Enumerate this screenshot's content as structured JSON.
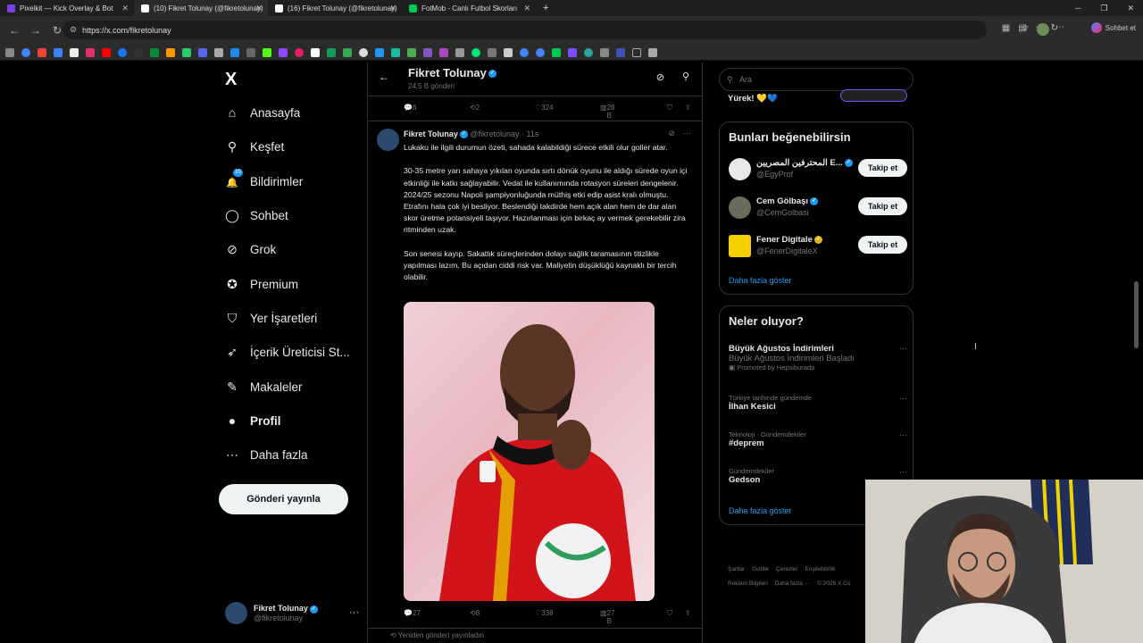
{
  "browser": {
    "tabs": [
      {
        "title": "Pixelkit — Kick Overlay & Bot",
        "color": "#7b3fe4"
      },
      {
        "title": "(10) Fikret Tolunay (@fikretolunay)",
        "color": "#ffffff"
      },
      {
        "title": "(16) Fikret Tolunay (@fikretolunay)",
        "color": "#ffffff"
      },
      {
        "title": "FotMob - Canlı Futbol Skorları",
        "color": "#00c853"
      }
    ],
    "url": "https://x.com/fikretolunay",
    "sohbet": "Sohbet et"
  },
  "leftnav": {
    "logo": "X",
    "items": [
      {
        "label": "Anasayfa",
        "icon": "home-icon",
        "glyph": "⌂"
      },
      {
        "label": "Keşfet",
        "icon": "search-icon",
        "glyph": "⚲"
      },
      {
        "label": "Bildirimler",
        "icon": "bell-icon",
        "glyph": "🔔"
      },
      {
        "label": "Sohbet",
        "icon": "chat-icon",
        "glyph": "◯"
      },
      {
        "label": "Grok",
        "icon": "grok-icon",
        "glyph": "⊘"
      },
      {
        "label": "Premium",
        "icon": "premium-icon",
        "glyph": "✪"
      },
      {
        "label": "Yer İşaretleri",
        "icon": "bookmark-icon",
        "glyph": "⛉"
      },
      {
        "label": "İçerik Üreticisi St...",
        "icon": "rocket-icon",
        "glyph": "➶"
      },
      {
        "label": "Makaleler",
        "icon": "article-icon",
        "glyph": "✎"
      },
      {
        "label": "Profil",
        "icon": "profile-icon",
        "glyph": "●"
      },
      {
        "label": "Daha fazla",
        "icon": "more-icon",
        "glyph": "⋯"
      }
    ],
    "badge": "10",
    "post_button": "Gönderi yayınla",
    "account": {
      "name": "Fikret Tolunay",
      "handle": "@fikretolunay"
    }
  },
  "main": {
    "header": {
      "name": "Fikret Tolunay",
      "count": "24,5 B gönderi"
    },
    "prev_actions": {
      "replies": "8",
      "reposts": "2",
      "likes": "324",
      "views": "28 B"
    },
    "tweet": {
      "name": "Fikret Tolunay",
      "handle": "@fikretolunay",
      "time": "· 11s",
      "paragraphs": [
        "Lukaku ile ilgili durumun özeti, sahada kalabildiği sürece etkili olur goller atar.",
        "30-35 metre yarı sahaya yıkılan oyunda sırtı dönük oyunu ile aldığı sürede oyun içi etkinliği ile katkı sağlayabilir. Vedat ile kullanımında rotasyon süreleri dengelenir. 2024/25 sezonu Napoli şampiyonluğunda müthiş etki edip asist kralı olmuştu. Etrafını hala çok iyi besliyor. Beslendiği takdirde hem açık alan hem de dar alan skor üretme potansiyeli taşıyor. Hazırlanması için birkaç ay vermek gerekebilir zira ritminden uzak.",
        "Son senesi kayıp. Sakatlık süreçlerinden dolayı sağlık taramasının titizlikle yapılması lazım. Bu açıdan ciddi risk var. Maliyetin düşüklüğü kaynaklı bir tercih olabilir."
      ],
      "actions": {
        "replies": "27",
        "reposts": "8",
        "likes": "338",
        "views": "27 B"
      }
    },
    "retweeted": "Yeniden gönderi yayınladın"
  },
  "right": {
    "search_placeholder": "Ara",
    "top_snippet": "Yürek! 💛💙",
    "suggest_title": "Bunları beğenebilirsin",
    "suggestions": [
      {
        "name": "المحترفين المصريين E...",
        "handle": "@EgyProf",
        "badge": "blue",
        "avatar_color": "#e8e8e8"
      },
      {
        "name": "Cem Gölbaşı",
        "handle": "@CemGolbasi",
        "badge": "blue",
        "avatar_color": "#6b6b5a"
      },
      {
        "name": "Fener Digitale",
        "handle": "@FenerDigitaleX",
        "badge": "gold",
        "avatar_color": "#f5d000"
      }
    ],
    "follow_label": "Takip et",
    "more_label": "Daha fazla göster",
    "trends_title": "Neler oluyor?",
    "trends": [
      {
        "ctx": "",
        "title": "Büyük Ağustos İndirimleri",
        "sub": "Büyük Ağustos İndirimleri Başladı",
        "promo": "Promoted by Hepsiburada"
      },
      {
        "ctx": "Türkiye tarihinde gündemde",
        "title": "İlhan Kesici",
        "sub": "",
        "promo": ""
      },
      {
        "ctx": "Teknoloji · Gündemdekiler",
        "title": "#deprem",
        "sub": "",
        "promo": ""
      },
      {
        "ctx": "Gündemdekiler",
        "title": "Gedson",
        "sub": "",
        "promo": ""
      }
    ],
    "trends_more": "Daha fazla göster",
    "footer": [
      "Şartlar",
      "Gizlilik",
      "Çerezler",
      "Erişilebilirlik",
      "Reklam Bilgileri",
      "Daha fazla ···",
      "© 2026 X Co"
    ]
  }
}
